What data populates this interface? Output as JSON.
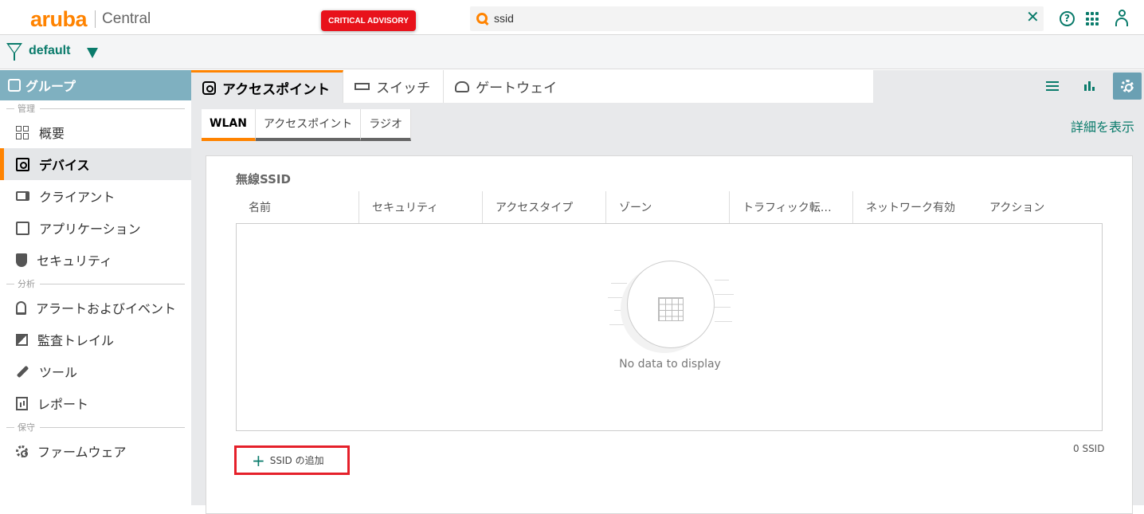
{
  "header": {
    "brand": "aruba",
    "product": "Central",
    "advisory_label": "CRITICAL ADVISORY",
    "search_value": "ssid",
    "clear_symbol": "✕",
    "help_symbol": "?"
  },
  "filter": {
    "label": "default"
  },
  "sidebar": {
    "header": "グループ",
    "sections": [
      {
        "title": "管理",
        "items": [
          "概要",
          "デバイス",
          "クライアント",
          "アプリケーション",
          "セキュリティ"
        ]
      },
      {
        "title": "分析",
        "items": [
          "アラートおよびイベント",
          "監査トレイル",
          "ツール",
          "レポート"
        ]
      },
      {
        "title": "保守",
        "items": [
          "ファームウェア"
        ]
      }
    ],
    "active_item": "デバイス"
  },
  "tabs": [
    {
      "label": "アクセスポイント",
      "active": true,
      "icon": "access-point-icon"
    },
    {
      "label": "スイッチ",
      "active": false,
      "icon": "switch-icon"
    },
    {
      "label": "ゲートウェイ",
      "active": false,
      "icon": "gateway-icon"
    }
  ],
  "subtabs": [
    {
      "label": "WLAN",
      "active": true
    },
    {
      "label": "アクセスポイント",
      "active": false
    },
    {
      "label": "ラジオ",
      "active": false
    }
  ],
  "detail_link": "詳細を表示",
  "panel": {
    "title": "無線SSID",
    "columns": [
      "名前",
      "セキュリティ",
      "アクセスタイプ",
      "ゾーン",
      "トラフィック転…",
      "ネットワーク有効",
      "アクション"
    ],
    "empty_text": "No data to display",
    "add_button": "SSID の追加",
    "count": "0 SSID"
  },
  "colors": {
    "accent": "#ff8300",
    "teal": "#0a7b6b",
    "advisory": "#e8121b",
    "sidebar_header": "#7fb0c0",
    "highlight_border": "#e5202a"
  }
}
